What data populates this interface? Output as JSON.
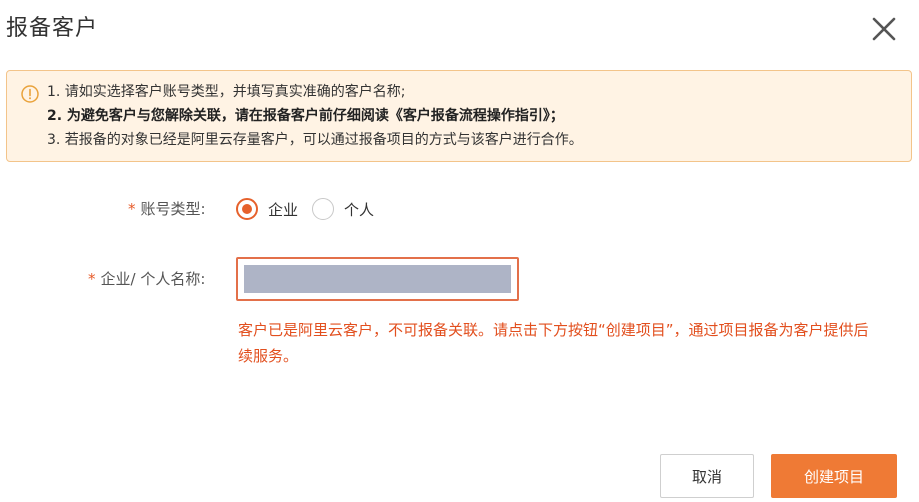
{
  "dialog": {
    "title": "报备客户"
  },
  "notice": {
    "icon": "warning-circle-icon",
    "lines": [
      "1. 请如实选择客户账号类型，并填写真实准确的客户名称;",
      "2. 为避免客户与您解除关联，请在报备客户前仔细阅读《客户报备流程操作指引》；",
      "3. 若报备的对象已经是阿里云存量客户，可以通过报备项目的方式与该客户进行合作。"
    ]
  },
  "form": {
    "required_mark": "*",
    "account_type": {
      "label": "账号类型:",
      "options": [
        {
          "label": "企业",
          "checked": true
        },
        {
          "label": "个人",
          "checked": false
        }
      ]
    },
    "name": {
      "label": "企业/ 个人名称:",
      "value": ""
    },
    "error": "客户已是阿里云客户，不可报备关联。请点击下方按钮“创建项目”，通过项目报备为客户提供后续服务。"
  },
  "footer": {
    "cancel_label": "取消",
    "create_label": "创建项目"
  },
  "colors": {
    "accent": "#ef7a35",
    "error": "#e24f1e",
    "notice_bg": "#fff3e4",
    "notice_border": "#f3c48a"
  }
}
